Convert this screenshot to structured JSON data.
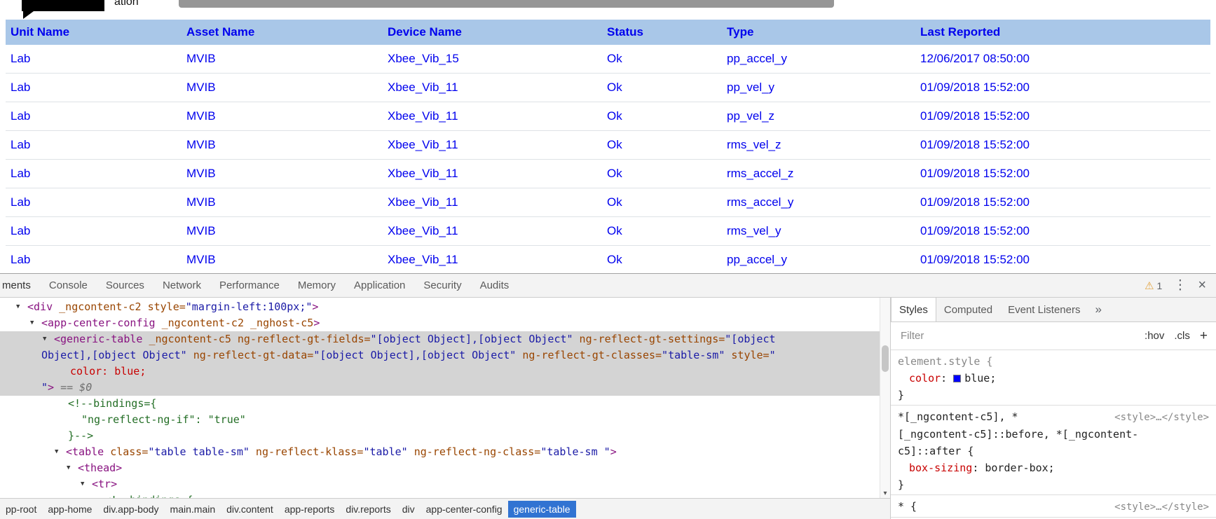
{
  "page": {
    "partial_title": "ation"
  },
  "colors": {
    "table_text": "#0000ee",
    "table_header_bg": "#a9c7e8",
    "row_border": "#dee2e6",
    "selected_node_bg": "#d4d4d4",
    "selected_crumb_bg": "#3173d2",
    "syntax_tag": "#881280",
    "syntax_attr": "#994500",
    "syntax_value": "#1a1aa6",
    "syntax_comment": "#236e25",
    "css_property": "#c80000",
    "swatch_blue": "#0000ff"
  },
  "icons": {
    "warning": "⚠",
    "menu": "⋮",
    "close": "×",
    "more_tabs": "»",
    "scroll_down": "▾",
    "expand": "▼"
  },
  "table": {
    "columns": [
      "Unit Name",
      "Asset Name",
      "Device Name",
      "Status",
      "Type",
      "Last Reported"
    ],
    "rows": [
      [
        "Lab",
        "MVIB",
        "Xbee_Vib_15",
        "Ok",
        "pp_accel_y",
        "12/06/2017 08:50:00"
      ],
      [
        "Lab",
        "MVIB",
        "Xbee_Vib_11",
        "Ok",
        "pp_vel_y",
        "01/09/2018 15:52:00"
      ],
      [
        "Lab",
        "MVIB",
        "Xbee_Vib_11",
        "Ok",
        "pp_vel_z",
        "01/09/2018 15:52:00"
      ],
      [
        "Lab",
        "MVIB",
        "Xbee_Vib_11",
        "Ok",
        "rms_vel_z",
        "01/09/2018 15:52:00"
      ],
      [
        "Lab",
        "MVIB",
        "Xbee_Vib_11",
        "Ok",
        "rms_accel_z",
        "01/09/2018 15:52:00"
      ],
      [
        "Lab",
        "MVIB",
        "Xbee_Vib_11",
        "Ok",
        "rms_accel_y",
        "01/09/2018 15:52:00"
      ],
      [
        "Lab",
        "MVIB",
        "Xbee_Vib_11",
        "Ok",
        "rms_vel_y",
        "01/09/2018 15:52:00"
      ],
      [
        "Lab",
        "MVIB",
        "Xbee_Vib_11",
        "Ok",
        "pp_accel_y",
        "01/09/2018 15:52:00"
      ]
    ]
  },
  "devtools": {
    "tabs": [
      {
        "label": "ments",
        "selected": true
      },
      {
        "label": "Console",
        "selected": false
      },
      {
        "label": "Sources",
        "selected": false
      },
      {
        "label": "Network",
        "selected": false
      },
      {
        "label": "Performance",
        "selected": false
      },
      {
        "label": "Memory",
        "selected": false
      },
      {
        "label": "Application",
        "selected": false
      },
      {
        "label": "Security",
        "selected": false
      },
      {
        "label": "Audits",
        "selected": false
      }
    ],
    "warning_count": "1",
    "tree": {
      "lines": [
        {
          "indent": 39,
          "arrow": true,
          "sel": false,
          "segs": [
            [
              "tag",
              "<div"
            ],
            [
              "attr",
              " _ngcontent-c2 style="
            ],
            [
              "val",
              "\"margin-left:100px;\""
            ],
            [
              "tag",
              ">"
            ]
          ]
        },
        {
          "indent": 59,
          "arrow": true,
          "sel": false,
          "segs": [
            [
              "tag",
              "<app-center-config"
            ],
            [
              "attr",
              " _ngcontent-c2 _nghost-c5"
            ],
            [
              "tag",
              ">"
            ]
          ]
        },
        {
          "indent": 77,
          "arrow": true,
          "sel": true,
          "segs": [
            [
              "tag",
              "<generic-table"
            ],
            [
              "attr",
              " _ngcontent-c5 ng-reflect-gt-fields="
            ],
            [
              "val",
              "\"[object Object],[object Object\""
            ],
            [
              "attr",
              " ng-reflect-gt-settings="
            ],
            [
              "val",
              "\"[object"
            ]
          ]
        },
        {
          "indent": 59,
          "arrow": false,
          "sel": true,
          "segs": [
            [
              "val",
              "Object],[object Object\""
            ],
            [
              "attr",
              " ng-reflect-gt-data="
            ],
            [
              "val",
              "\"[object Object],[object Object\""
            ],
            [
              "attr",
              " ng-reflect-gt-classes="
            ],
            [
              "val",
              "\"table-sm\""
            ],
            [
              "attr",
              " style="
            ],
            [
              "val",
              "\""
            ]
          ]
        },
        {
          "indent": 100,
          "arrow": false,
          "sel": true,
          "segs": [
            [
              "css",
              "color: blue;"
            ]
          ]
        },
        {
          "indent": 59,
          "arrow": false,
          "sel": true,
          "segs": [
            [
              "val",
              "\""
            ],
            [
              "tag",
              ">"
            ],
            [
              "dim",
              " == $0"
            ]
          ]
        },
        {
          "indent": 97,
          "arrow": false,
          "sel": false,
          "segs": [
            [
              "com",
              "<!--bindings={"
            ]
          ]
        },
        {
          "indent": 116,
          "arrow": false,
          "sel": false,
          "segs": [
            [
              "com",
              "\"ng-reflect-ng-if\": \"true\""
            ]
          ]
        },
        {
          "indent": 97,
          "arrow": false,
          "sel": false,
          "segs": [
            [
              "com",
              "}-->"
            ]
          ]
        },
        {
          "indent": 94,
          "arrow": true,
          "sel": false,
          "segs": [
            [
              "tag",
              "<table"
            ],
            [
              "attr",
              " class="
            ],
            [
              "val",
              "\"table table-sm\""
            ],
            [
              "attr",
              " ng-reflect-klass="
            ],
            [
              "val",
              "\"table\""
            ],
            [
              "attr",
              " ng-reflect-ng-class="
            ],
            [
              "val",
              "\"table-sm \""
            ],
            [
              "tag",
              ">"
            ]
          ]
        },
        {
          "indent": 111,
          "arrow": true,
          "sel": false,
          "segs": [
            [
              "tag",
              "<thead>"
            ]
          ]
        },
        {
          "indent": 131,
          "arrow": true,
          "sel": false,
          "segs": [
            [
              "tag",
              "<tr>"
            ]
          ]
        },
        {
          "indent": 149,
          "arrow": false,
          "sel": false,
          "segs": [
            [
              "com",
              "<!--bindings={"
            ]
          ]
        }
      ]
    },
    "styles_panel": {
      "tabs": [
        {
          "label": "Styles",
          "selected": true
        },
        {
          "label": "Computed",
          "selected": false
        },
        {
          "label": "Event Listeners",
          "selected": false
        }
      ],
      "filter_placeholder": "Filter",
      "hov_label": ":hov",
      "cls_label": ".cls",
      "plus_label": "+",
      "rules": [
        {
          "selector_lines": [
            "element.style {"
          ],
          "gray_selector": true,
          "source": "",
          "props": [
            {
              "name": "color",
              "value": "blue",
              "swatch": "#0000ff"
            }
          ],
          "close": "}"
        },
        {
          "selector_lines": [
            "*[_ngcontent-c5], *",
            "[_ngcontent-c5]::before, *[_ngcontent-",
            "c5]::after {"
          ],
          "gray_selector": false,
          "source": "<style>…</style>",
          "props": [
            {
              "name": "box-sizing",
              "value": "border-box"
            }
          ],
          "close": "}"
        },
        {
          "selector_lines": [
            "* {"
          ],
          "gray_selector": false,
          "source": "<style>…</style>",
          "props": [],
          "close": ""
        }
      ]
    },
    "breadcrumbs": [
      {
        "label": "pp-root",
        "selected": false
      },
      {
        "label": "app-home",
        "selected": false
      },
      {
        "label": "div.app-body",
        "selected": false
      },
      {
        "label": "main.main",
        "selected": false
      },
      {
        "label": "div.content",
        "selected": false
      },
      {
        "label": "app-reports",
        "selected": false
      },
      {
        "label": "div.reports",
        "selected": false
      },
      {
        "label": "div",
        "selected": false
      },
      {
        "label": "app-center-config",
        "selected": false
      },
      {
        "label": "generic-table",
        "selected": true
      }
    ]
  }
}
